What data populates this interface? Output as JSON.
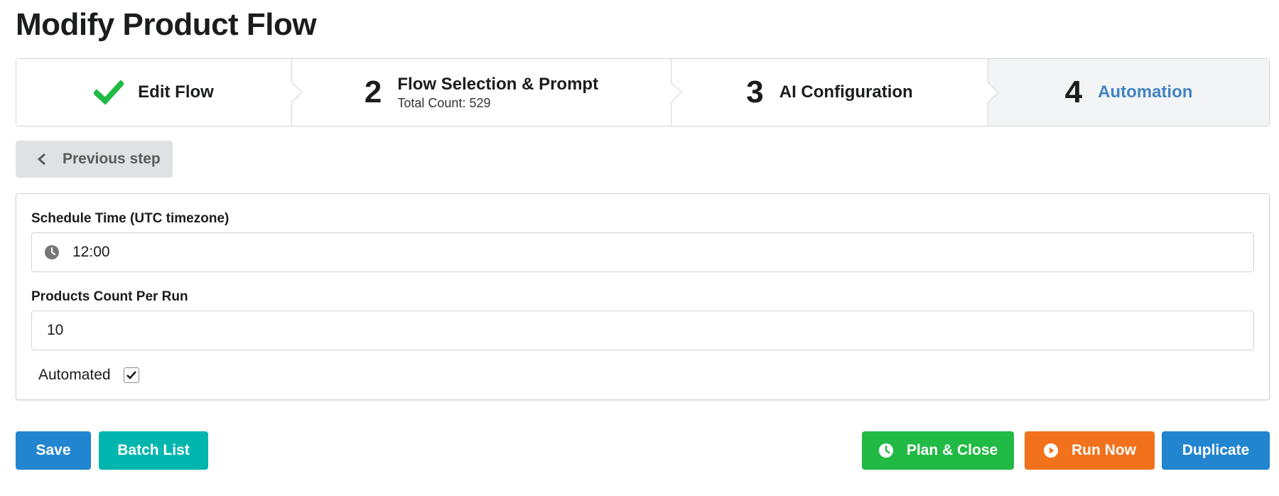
{
  "page": {
    "title": "Modify Product Flow"
  },
  "steps": [
    {
      "label": "Edit Flow",
      "icon": "check-icon",
      "state": "completed"
    },
    {
      "number": "2",
      "label": "Flow Selection & Prompt",
      "sub": "Total Count: 529"
    },
    {
      "number": "3",
      "label": "AI Configuration"
    },
    {
      "number": "4",
      "label": "Automation",
      "state": "active"
    }
  ],
  "prev_step": {
    "label": "Previous step",
    "icon": "chevron-left-icon"
  },
  "form": {
    "schedule": {
      "label": "Schedule Time (UTC timezone)",
      "value": "12:00",
      "icon": "clock-icon"
    },
    "products_count": {
      "label": "Products Count Per Run",
      "value": "10"
    },
    "automated": {
      "label": "Automated",
      "checked": true
    }
  },
  "actions": {
    "save": "Save",
    "batch_list": "Batch List",
    "plan_close": "Plan & Close",
    "run_now": "Run Now",
    "duplicate": "Duplicate"
  },
  "colors": {
    "blue": "#2185d0",
    "teal": "#00b5ad",
    "green": "#21ba45",
    "orange": "#f2711c",
    "active_step": "#4183c4",
    "check": "#21ba45"
  }
}
